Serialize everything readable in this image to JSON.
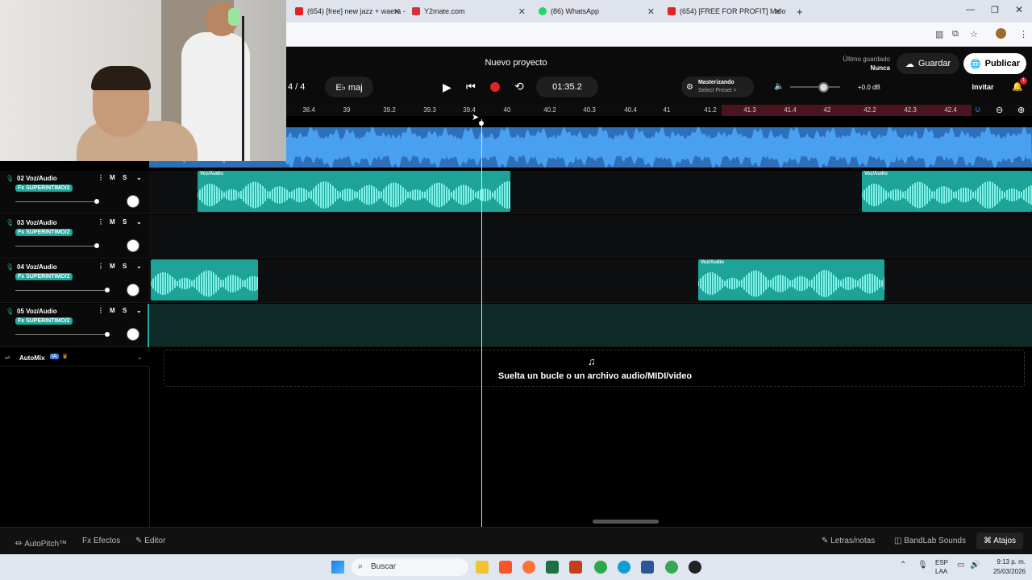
{
  "browser": {
    "tabs": [
      {
        "label": "(654) [free] new jazz + waera -",
        "color": "#e02424"
      },
      {
        "label": "Y2mate.com",
        "color": "#d3323c"
      },
      {
        "label": "(86) WhatsApp",
        "color": "#25d366"
      },
      {
        "label": "(654) [FREE FOR PROFIT] Melo",
        "color": "#e02424"
      }
    ],
    "new_tab": "+"
  },
  "app": {
    "project_title": "Nuevo proyecto",
    "last_saved_label": "Último guardado",
    "last_saved_value": "Nunca",
    "save_button": "Guardar",
    "publish_button": "Publicar",
    "time_signature": "4 / 4",
    "key": "E♭ maj",
    "time": "01:35.2",
    "mastering_label": "Masterizando",
    "mastering_preset": "Select Preset >",
    "volume_db": "+0.0 dB",
    "invite_button": "Invitar",
    "notification_count": "1"
  },
  "ruler": {
    "ticks": [
      "38.4",
      "39",
      "39.2",
      "39.3",
      "39.4",
      "40",
      "40.2",
      "40.3",
      "40.4",
      "41",
      "41.2",
      "41.3",
      "41.4",
      "42",
      "42.2",
      "42.3",
      "42.4"
    ]
  },
  "tracks": [
    {
      "number": "02",
      "name": "Voz/Audio",
      "fx": "Fx SUPERINTIMO/2",
      "mute": "M",
      "solo": "S"
    },
    {
      "number": "03",
      "name": "Voz/Audio",
      "fx": "Fx SUPERINTIMO/2",
      "mute": "M",
      "solo": "S"
    },
    {
      "number": "04",
      "name": "Voz/Audio",
      "fx": "Fx SUPERINTIMO/2",
      "mute": "M",
      "solo": "S"
    },
    {
      "number": "05",
      "name": "Voz/Audio",
      "fx": "Fx SUPERINTIMO/2",
      "mute": "M",
      "solo": "S"
    }
  ],
  "clip_label": "Voz/Audio",
  "automix": {
    "label": "AutoMix",
    "badge": "IA"
  },
  "drop_zone": "Suelta un bucle o un archivo audio/MIDI/video",
  "bottom_bar": {
    "autopitch": "AutoPitch™",
    "effects": "Efectos",
    "editor": "Editor",
    "lyrics": "Letras/notas",
    "sounds": "BandLab Sounds",
    "shortcuts": "Atajos"
  },
  "taskbar": {
    "search_placeholder": "Buscar",
    "lang_top": "ESP",
    "lang_bottom": "LAA",
    "time": "9:13 p. m.",
    "date": "25/03/2026"
  },
  "colors": {
    "accent": "#1da398",
    "record": "#e02424",
    "overview": "#2d6fb9"
  }
}
